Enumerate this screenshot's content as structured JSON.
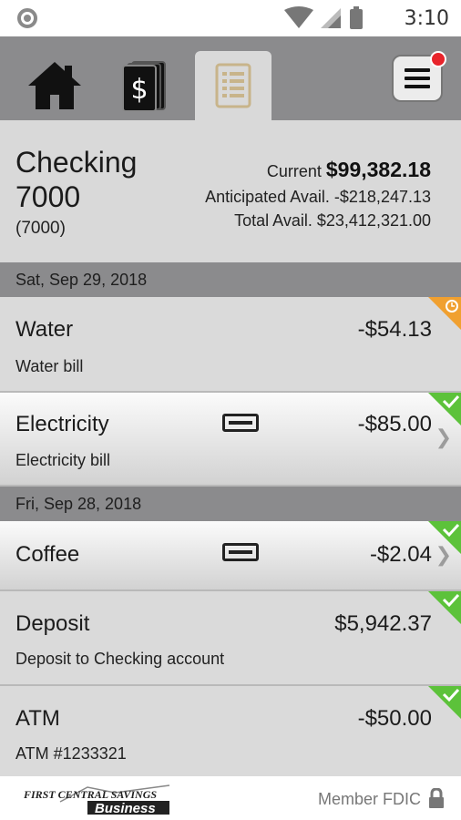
{
  "status_bar": {
    "time": "3:10"
  },
  "tabs": [
    {
      "name": "home",
      "icon": "home-icon",
      "active": false
    },
    {
      "name": "accounts",
      "icon": "money-icon",
      "active": false
    },
    {
      "name": "register",
      "icon": "register-icon",
      "active": true
    }
  ],
  "menu": {
    "icon": "hamburger-menu-icon",
    "has_notification": true
  },
  "account": {
    "name": "Checking 7000",
    "number": "(7000)",
    "current_label": "Current",
    "current_value": "$99,382.18",
    "anticipated": "Anticipated Avail. -$218,247.13",
    "total": "Total Avail. $23,412,321.00"
  },
  "groups": [
    {
      "date": "Sat, Sep 29, 2018",
      "transactions": [
        {
          "title": "Water",
          "description": "Water bill",
          "amount": "-$54.13",
          "status": "pending",
          "card": false,
          "chevron": false
        },
        {
          "title": "Electricity",
          "description": "Electricity bill",
          "amount": "-$85.00",
          "status": "cleared",
          "card": true,
          "chevron": true
        }
      ]
    },
    {
      "date": "Fri, Sep 28, 2018",
      "transactions": [
        {
          "title": "Coffee",
          "description": "",
          "amount": "-$2.04",
          "status": "cleared",
          "card": true,
          "chevron": true
        },
        {
          "title": "Deposit",
          "description": "Deposit to Checking account",
          "amount": "$5,942.37",
          "status": "cleared",
          "card": false,
          "chevron": false
        },
        {
          "title": "ATM",
          "description": "ATM #1233321",
          "amount": "-$50.00",
          "status": "cleared",
          "card": false,
          "chevron": false
        }
      ]
    }
  ],
  "footer": {
    "logo_top": "FIRST CENTRAL SAVINGS",
    "logo_bottom": "Business",
    "fdic": "Member FDIC"
  },
  "colors": {
    "pending": "#f0a030",
    "cleared": "#5cc23a",
    "badge": "#e8242b",
    "register_tab_icon": "#c8b48a"
  }
}
